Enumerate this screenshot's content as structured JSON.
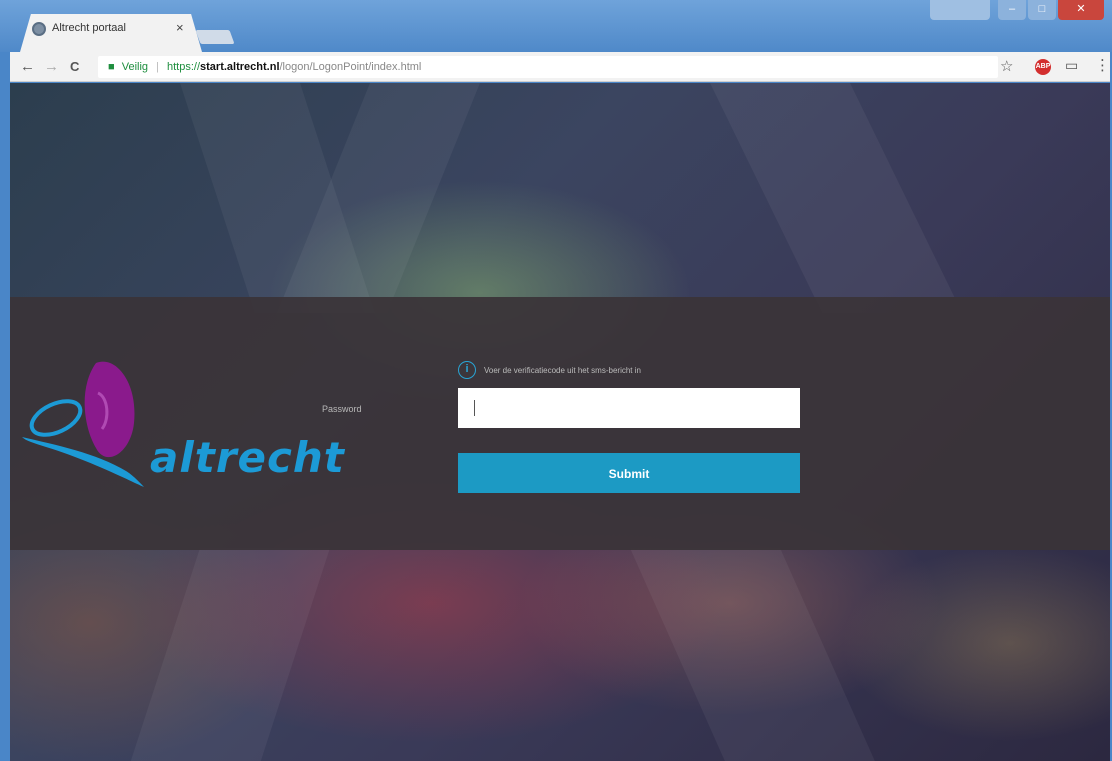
{
  "browser": {
    "tab_title": "Altrecht portaal",
    "tab_close": "×",
    "security_label": "Veilig",
    "url_scheme": "https://",
    "url_domain": "start.altrecht.nl",
    "url_path": "/logon/LogonPoint/index.html",
    "nav_back": "←",
    "nav_forward": "→",
    "nav_reload": "C",
    "extension_label": "ABP",
    "window_controls": {
      "minimize": "–",
      "maximize": "□",
      "close": "✕"
    }
  },
  "login": {
    "logo_text": "altrecht",
    "info_message": "Voer de verificatiecode uit het sms-bericht in",
    "password_label": "Password",
    "password_value": "",
    "submit_label": "Submit"
  },
  "colors": {
    "accent": "#1c9ac4",
    "logo_blue": "#1c9ad6",
    "logo_purple": "#8a1a8c",
    "band": "#3a3438"
  },
  "icons": [
    "favicon-icon",
    "close-icon",
    "back-arrow-icon",
    "forward-arrow-icon",
    "reload-icon",
    "lock-icon",
    "star-icon",
    "adblock-icon",
    "cast-icon",
    "menu-icon",
    "info-icon"
  ]
}
